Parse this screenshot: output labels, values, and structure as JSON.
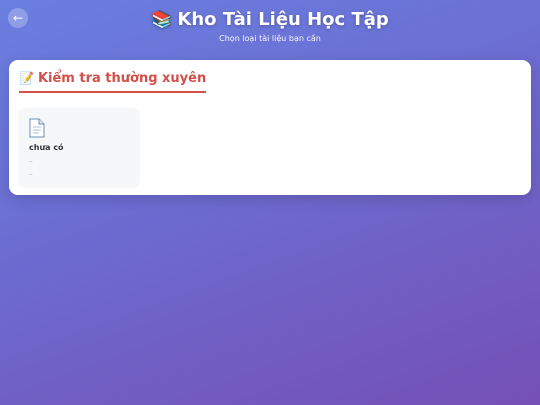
{
  "header": {
    "back_label": "←",
    "title_emoji": "📚",
    "title": "Kho Tài Liệu Học Tập",
    "subtitle": "Chọn loại tài liệu bạn cần"
  },
  "section": {
    "emoji": "📝",
    "title": "Kiểm tra thường xuyên",
    "accent_color": "#d2504a"
  },
  "documents": [
    {
      "icon": "document-icon",
      "name": "chưa có",
      "meta1": "..",
      "meta2": ".."
    }
  ]
}
